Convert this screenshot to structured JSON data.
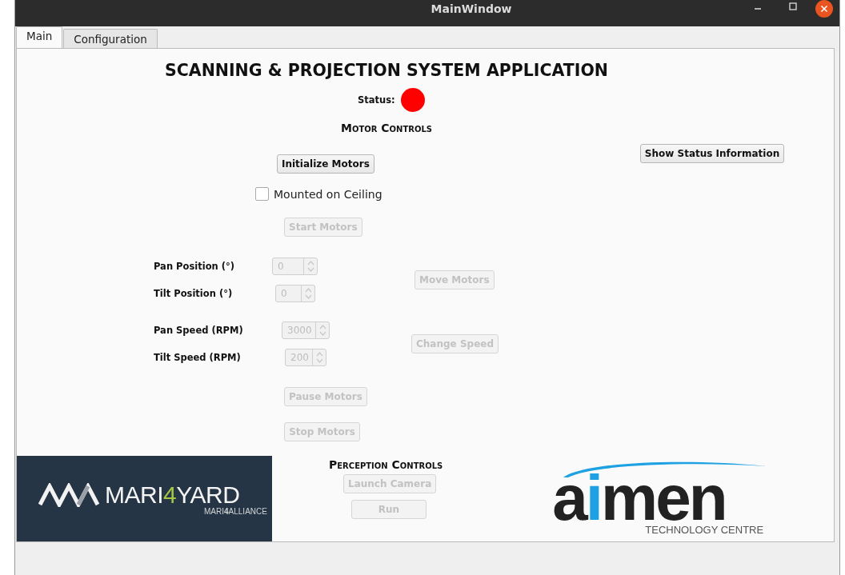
{
  "window": {
    "title": "MainWindow"
  },
  "tabs": [
    {
      "label": "Main",
      "selected": true
    },
    {
      "label": "Configuration",
      "selected": false
    }
  ],
  "heading": "SCANNING & PROJECTION SYSTEM APPLICATION",
  "status": {
    "label": "Status:",
    "color": "#ff0000"
  },
  "motor_controls": {
    "heading": "Motor Controls",
    "initialize_button": {
      "label": "Initialize Motors",
      "disabled": false
    },
    "show_status_button": {
      "label": "Show Status Information",
      "disabled": false
    },
    "ceiling_checkbox": {
      "label": "Mounted on Ceiling",
      "checked": false
    },
    "start_button": {
      "label": "Start Motors",
      "disabled": true
    },
    "position_fields": [
      {
        "label": "Pan Position (°)",
        "value": "0",
        "disabled": true
      },
      {
        "label": "Tilt Position (°)",
        "value": "0",
        "disabled": true
      }
    ],
    "move_button": {
      "label": "Move Motors",
      "disabled": true
    },
    "speed_fields": [
      {
        "label": "Pan Speed (RPM)",
        "value": "3000",
        "disabled": true
      },
      {
        "label": "Tilt Speed (RPM)",
        "value": "200",
        "disabled": true
      }
    ],
    "change_speed_button": {
      "label": "Change Speed",
      "disabled": true
    },
    "pause_button": {
      "label": "Pause Motors",
      "disabled": true
    },
    "stop_button": {
      "label": "Stop Motors",
      "disabled": true
    }
  },
  "perception_controls": {
    "heading": "Perception Controls",
    "launch_button": {
      "label": "Launch Camera",
      "disabled": true
    },
    "run_button": {
      "label": "Run",
      "disabled": true
    }
  },
  "logos": {
    "mari4yard": {
      "name": [
        {
          "text": "MARI",
          "highlight": false
        },
        {
          "text": "4",
          "highlight": true
        },
        {
          "text": "YARD",
          "highlight": false
        }
      ],
      "tagline": [
        {
          "text": "MARI",
          "highlight": false
        },
        {
          "text": "4",
          "highlight": true
        },
        {
          "text": "ALLIANCE",
          "highlight": false
        }
      ]
    },
    "aimen": {
      "name": [
        {
          "text": "a",
          "highlight": false
        },
        {
          "text": "i",
          "highlight": true
        },
        {
          "text": "men",
          "highlight": false
        }
      ],
      "tagline": "TECHNOLOGY CENTRE"
    }
  }
}
